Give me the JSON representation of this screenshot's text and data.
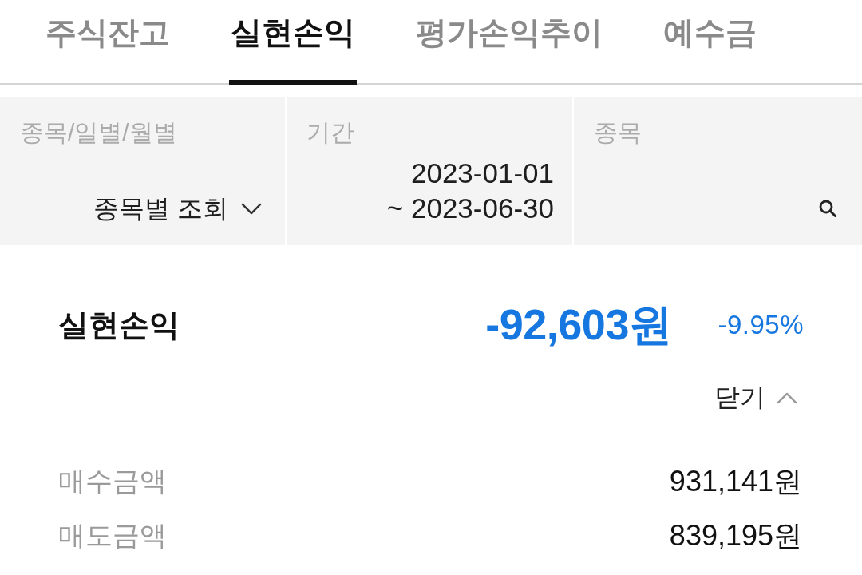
{
  "tabs": [
    {
      "label": "주식잔고",
      "selected": false
    },
    {
      "label": "실현손익",
      "selected": true
    },
    {
      "label": "평가손익추이",
      "selected": false
    },
    {
      "label": "예수금",
      "selected": false
    }
  ],
  "filters": [
    {
      "kind": "dropdown",
      "label": "종목/일별/월별",
      "value": "종목별 조회"
    },
    {
      "kind": "date_range",
      "label": "기간",
      "start": "2023-01-01",
      "end": "~ 2023-06-30"
    },
    {
      "kind": "search",
      "label": "종목"
    }
  ],
  "summary": {
    "label": "실현손익",
    "amount": "-92,603원",
    "rate": "-9.95%",
    "toggle": {
      "label": "닫기",
      "expanded": true
    }
  },
  "details": [
    {
      "label": "매수금액",
      "value": "931,141원"
    },
    {
      "label": "매도금액",
      "value": "839,195원"
    }
  ]
}
